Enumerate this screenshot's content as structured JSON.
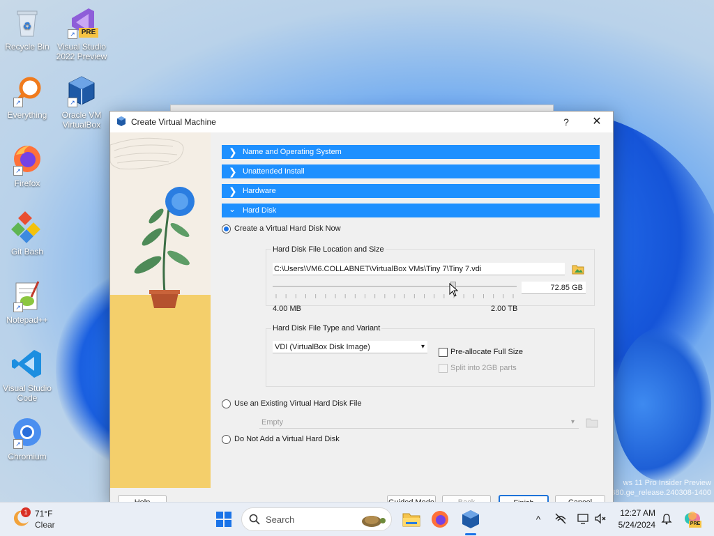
{
  "desktop": {
    "icons": [
      {
        "label": "Recycle Bin"
      },
      {
        "label": "Visual Studio 2022 Preview",
        "badge": "PRE"
      },
      {
        "label": "Everything"
      },
      {
        "label": "Oracle VM VirtualBox"
      },
      {
        "label": "Firefox"
      },
      {
        "label": "Git Bash"
      },
      {
        "label": "Notepad++"
      },
      {
        "label": "Visual Studio Code"
      },
      {
        "label": "Chromium"
      }
    ],
    "watermark": {
      "line1": "ws 11 Pro Insider Preview",
      "line2": "380.ge_release.240308-1400"
    }
  },
  "dialog": {
    "title": "Create Virtual Machine",
    "help_glyph": "?",
    "close_glyph": "✕",
    "sections": [
      {
        "label": "Name and Operating System",
        "expanded": false
      },
      {
        "label": "Unattended Install",
        "expanded": false
      },
      {
        "label": "Hardware",
        "expanded": false
      },
      {
        "label": "Hard Disk",
        "expanded": true
      }
    ],
    "options": {
      "create_new": "Create a Virtual Hard Disk Now",
      "use_existing": "Use an Existing Virtual Hard Disk File",
      "no_disk": "Do Not Add a Virtual Hard Disk",
      "selected": "create_new"
    },
    "location_group": {
      "label": "Hard Disk File Location and Size",
      "path": "C:\\Users\\VM6.COLLABNET\\VirtualBox VMs\\Tiny 7\\Tiny 7.vdi",
      "size_value": "72.85 GB",
      "min_label": "4.00 MB",
      "max_label": "2.00 TB",
      "slider_fraction": 0.74
    },
    "type_group": {
      "label": "Hard Disk File Type and Variant",
      "type_value": "VDI (VirtualBox Disk Image)",
      "preallocate_label": "Pre-allocate Full Size",
      "split_label": "Split into 2GB parts"
    },
    "existing_combo": "Empty",
    "buttons": {
      "help": "Help",
      "guided": "Guided Mode",
      "back": "Back",
      "finish": "Finish",
      "cancel": "Cancel"
    }
  },
  "taskbar": {
    "weather": {
      "badge": "1",
      "temp": "71°F",
      "condition": "Clear"
    },
    "search_placeholder": "Search",
    "clock": {
      "time": "12:27 AM",
      "date": "5/24/2024"
    },
    "copilot_badge": "PRE"
  },
  "colors": {
    "section": "#1e90ff",
    "accent": "#1a73e8",
    "taskbar": "#e9eef6"
  }
}
